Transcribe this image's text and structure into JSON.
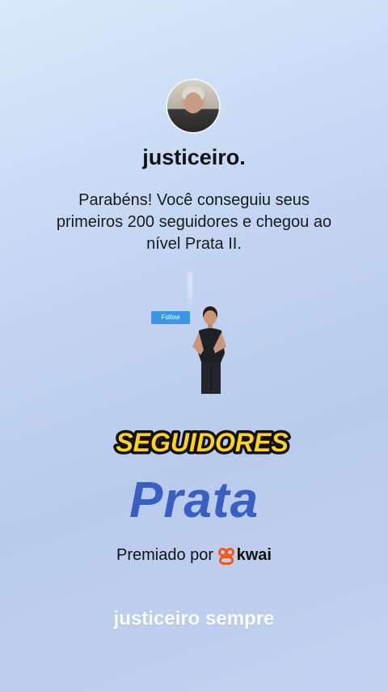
{
  "profile": {
    "username": "justiceiro."
  },
  "message": {
    "text": "Parabéns! Você conseguiu seus primeiros 200 seguidores e chegou ao nível Prata II."
  },
  "illustration": {
    "follow_label": "Follow"
  },
  "badge": {
    "label": "SEGUIDORES",
    "fill_color": "#ffd21f",
    "outline_color": "#111111"
  },
  "tier": {
    "label": "Prata",
    "color": "#3a5fc4"
  },
  "awarded": {
    "prefix": "Premiado por",
    "brand": "kwai",
    "brand_color": "#f25a1d"
  },
  "footer": {
    "text": "justiceiro sempre"
  }
}
